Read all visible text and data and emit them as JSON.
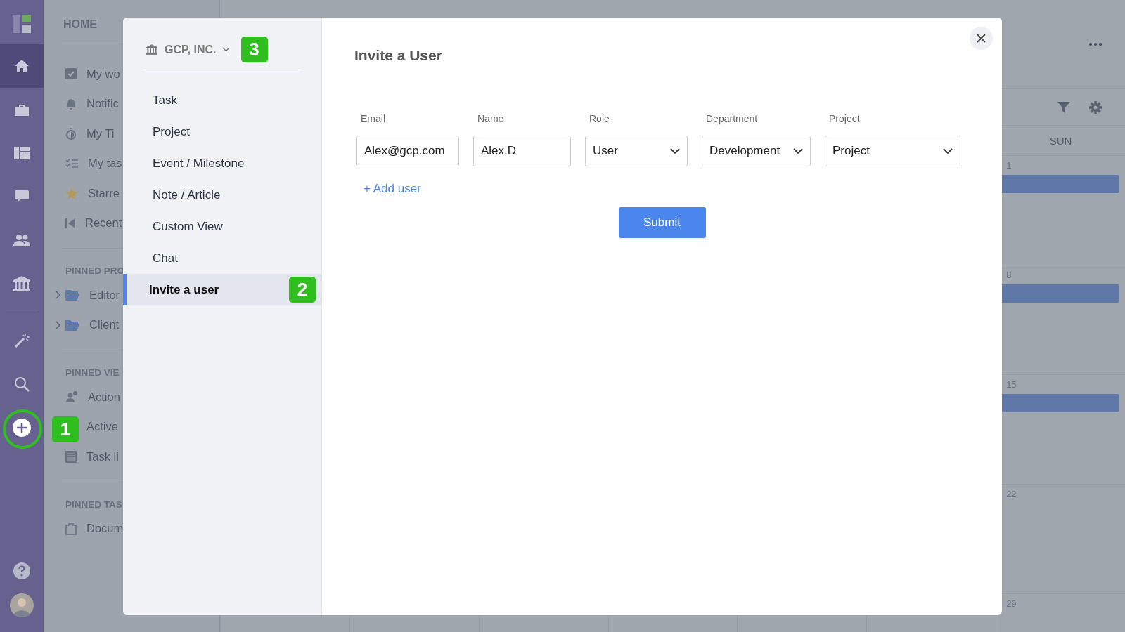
{
  "icon_rail": {
    "items": [
      {
        "selected": true
      },
      {
        "selected": false
      },
      {
        "selected": false
      },
      {
        "selected": false
      },
      {
        "selected": false
      },
      {
        "selected": false
      },
      {
        "selected": false
      },
      {
        "selected": false
      },
      {
        "selected": false
      }
    ]
  },
  "nav": {
    "title": "HOME",
    "items": [
      "My wo",
      "Notific",
      "My Ti",
      "My tas",
      "Starre",
      "Recent"
    ],
    "sections": [
      {
        "heading": "PINNED PRO",
        "items": [
          {
            "label": "Editor",
            "expanded": false
          },
          {
            "label": "Client",
            "expanded": false
          }
        ]
      },
      {
        "heading": "PINNED VIE",
        "items": [
          {
            "label": "Action"
          },
          {
            "label": "Active"
          },
          {
            "label": "Task li"
          }
        ]
      },
      {
        "heading": "PINNED TAS",
        "items": [
          {
            "label": "Docum"
          }
        ]
      }
    ]
  },
  "calendar": {
    "day_header": "SUN",
    "days": [
      {
        "number": "1",
        "event": true
      },
      {
        "number": "8",
        "event": true
      },
      {
        "number": "15",
        "event": true
      },
      {
        "number": "22",
        "event": false
      },
      {
        "number": "29",
        "event": false
      }
    ]
  },
  "modal": {
    "org": "GCP, INC.",
    "menu": [
      {
        "label": "Task",
        "selected": false
      },
      {
        "label": "Project",
        "selected": false
      },
      {
        "label": "Event / Milestone",
        "selected": false
      },
      {
        "label": "Note / Article",
        "selected": false
      },
      {
        "label": "Custom View",
        "selected": false
      },
      {
        "label": "Chat",
        "selected": false
      },
      {
        "label": "Invite a user",
        "selected": true
      }
    ],
    "title": "Invite a User",
    "fields": [
      {
        "label": "Email",
        "value": "Alex@gcp.com",
        "kind": "text"
      },
      {
        "label": "Name",
        "value": "Alex.D",
        "kind": "text"
      },
      {
        "label": "Role",
        "value": "User",
        "kind": "select"
      },
      {
        "label": "Department",
        "value": "Development",
        "kind": "select"
      },
      {
        "label": "Project",
        "value": "Project",
        "kind": "select"
      }
    ],
    "add_link": "+ Add user",
    "submit": "Submit"
  },
  "callouts": [
    "1",
    "2",
    "3"
  ]
}
